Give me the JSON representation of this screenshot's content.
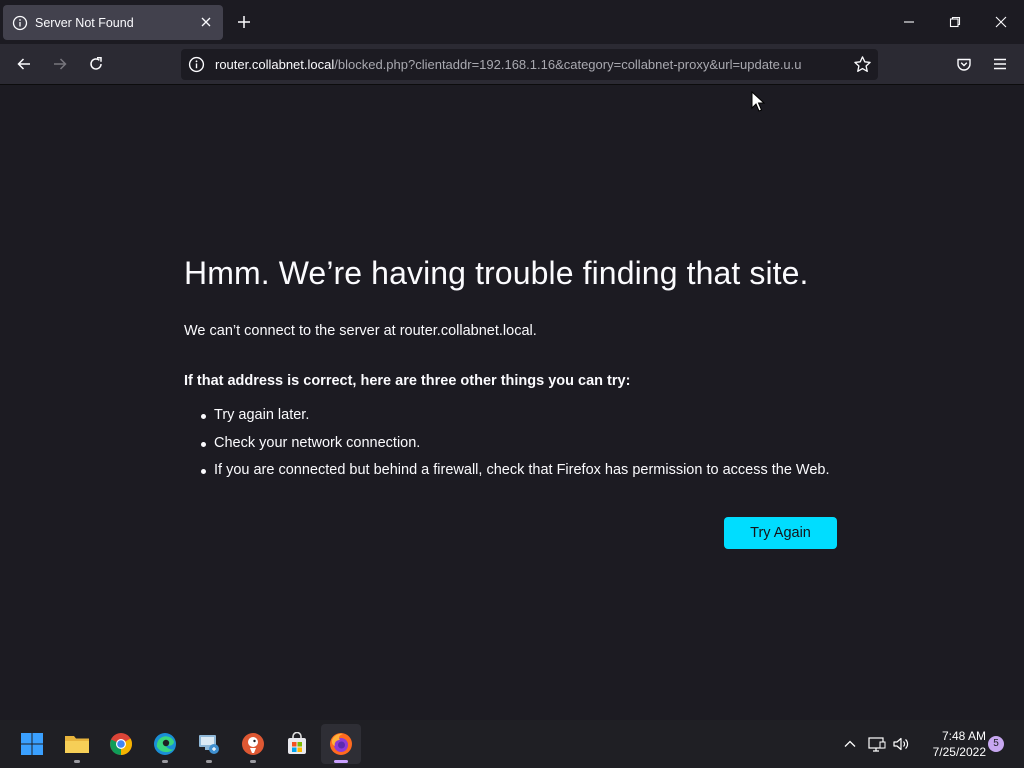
{
  "tab": {
    "title": "Server Not Found"
  },
  "urlbar": {
    "host": "router.collabnet.local",
    "path": "/blocked.php?clientaddr=192.168.1.16&category=collabnet-proxy&url=update.u.u"
  },
  "error": {
    "title": "Hmm. We’re having trouble finding that site.",
    "description": "We can’t connect to the server at router.collabnet.local.",
    "subheading": "If that address is correct, here are three other things you can try:",
    "suggestions": [
      "Try again later.",
      "Check your network connection.",
      "If you are connected but behind a firewall, check that Firefox has permission to access the Web."
    ],
    "button_label": "Try Again"
  },
  "taskbar": {
    "apps": [
      "start-icon",
      "file-explorer-icon",
      "chrome-icon",
      "edge-icon",
      "network-tool-icon",
      "duckduckgo-icon",
      "store-icon",
      "firefox-icon"
    ],
    "time": "7:48 AM",
    "date": "7/25/2022",
    "notification_count": "5"
  },
  "colors": {
    "accent": "#00ddff",
    "page_bg": "#1c1b22",
    "toolbar_bg": "#2b2a33"
  }
}
